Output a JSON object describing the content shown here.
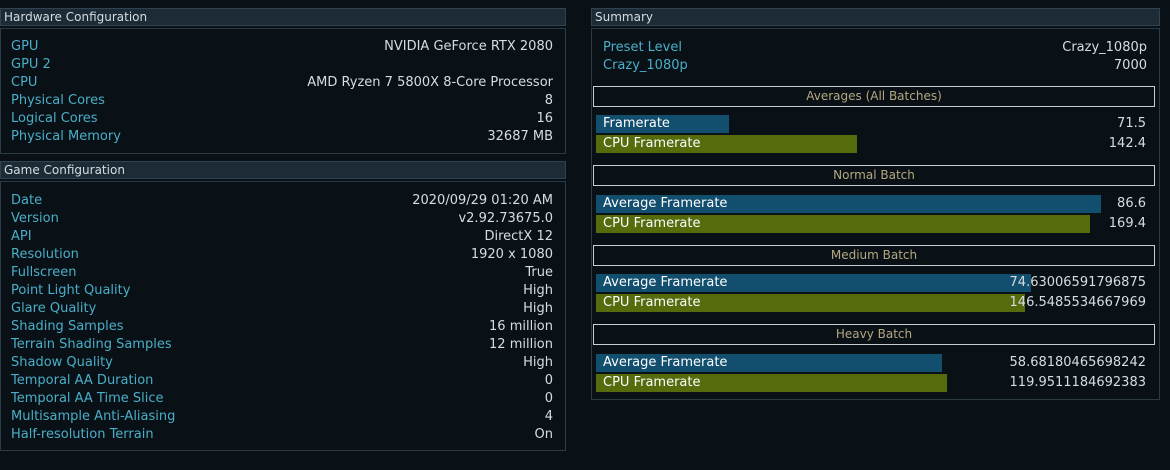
{
  "hardware": {
    "title": "Hardware Configuration",
    "rows": [
      {
        "key": "GPU",
        "value": "NVIDIA GeForce RTX 2080"
      },
      {
        "key": "GPU 2",
        "value": ""
      },
      {
        "key": "CPU",
        "value": "AMD Ryzen 7 5800X 8-Core Processor"
      },
      {
        "key": "Physical Cores",
        "value": "8"
      },
      {
        "key": "Logical Cores",
        "value": "16"
      },
      {
        "key": "Physical Memory",
        "value": "32687 MB"
      }
    ]
  },
  "game": {
    "title": "Game Configuration",
    "rows": [
      {
        "key": "Date",
        "value": "2020/09/29 01:20 AM"
      },
      {
        "key": "Version",
        "value": "v2.92.73675.0"
      },
      {
        "key": "API",
        "value": "DirectX 12"
      },
      {
        "key": "Resolution",
        "value": "1920 x 1080"
      },
      {
        "key": "Fullscreen",
        "value": "True"
      },
      {
        "key": "Point Light Quality",
        "value": "High"
      },
      {
        "key": "Glare Quality",
        "value": "High"
      },
      {
        "key": "Shading Samples",
        "value": "16 million"
      },
      {
        "key": "Terrain Shading Samples",
        "value": "12 million"
      },
      {
        "key": "Shadow Quality",
        "value": "High"
      },
      {
        "key": "Temporal AA Duration",
        "value": "0"
      },
      {
        "key": "Temporal AA Time Slice",
        "value": "0"
      },
      {
        "key": "Multisample Anti-Aliasing",
        "value": "4"
      },
      {
        "key": "Half-resolution Terrain",
        "value": "On"
      }
    ]
  },
  "summary": {
    "title": "Summary",
    "rows": [
      {
        "key": "Preset Level",
        "value": "Crazy_1080p"
      },
      {
        "key": "Crazy_1080p",
        "value": "7000"
      }
    ],
    "batches": [
      {
        "title": "Averages (All Batches)",
        "bars": [
          {
            "label": "Framerate",
            "value": "71.5",
            "kind": "fr",
            "fill": 0.24
          },
          {
            "label": "CPU Framerate",
            "value": "142.4",
            "kind": "cpu",
            "fill": 0.469
          }
        ]
      },
      {
        "title": "Normal Batch",
        "bars": [
          {
            "label": "Average Framerate",
            "value": "86.6",
            "kind": "fr",
            "fill": 0.908
          },
          {
            "label": "CPU Framerate",
            "value": "169.4",
            "kind": "cpu",
            "fill": 0.888
          }
        ]
      },
      {
        "title": "Medium Batch",
        "bars": [
          {
            "label": "Average Framerate",
            "value": "74.63006591796875",
            "kind": "fr",
            "fill": 0.782
          },
          {
            "label": "CPU Framerate",
            "value": "146.5485534667969",
            "kind": "cpu",
            "fill": 0.771
          }
        ]
      },
      {
        "title": "Heavy Batch",
        "bars": [
          {
            "label": "Average Framerate",
            "value": "58.68180465698242",
            "kind": "fr",
            "fill": 0.622
          },
          {
            "label": "CPU Framerate",
            "value": "119.9511184692383",
            "kind": "cpu",
            "fill": 0.631
          }
        ]
      }
    ]
  },
  "colors": {
    "framerate_bar": "#124e6e",
    "cpu_bar": "#556b0c",
    "label_cyan": "#4aaec8",
    "batch_title": "#b4a781"
  }
}
